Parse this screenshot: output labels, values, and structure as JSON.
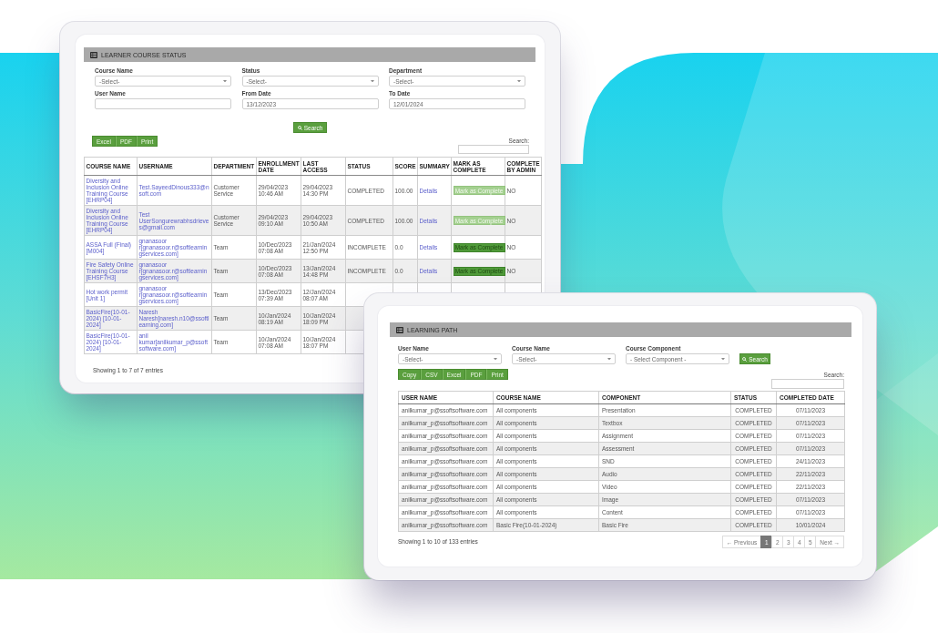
{
  "learner_course_status": {
    "title": "LEARNER COURSE STATUS",
    "filters": [
      {
        "kind": "select",
        "label": "Course Name",
        "value": "-Select-"
      },
      {
        "kind": "select",
        "label": "Status",
        "value": "-Select-"
      },
      {
        "kind": "select",
        "label": "Department",
        "value": "-Select-"
      },
      {
        "kind": "input",
        "label": "User Name"
      },
      {
        "kind": "input",
        "label": "From Date",
        "value": "13/12/2023"
      },
      {
        "kind": "input",
        "label": "To Date",
        "value": "12/01/2024"
      }
    ],
    "search_button": "Search",
    "export_buttons": [
      "Excel",
      "PDF",
      "Print"
    ],
    "table_search_label": "Search:",
    "table": {
      "columns": [
        {
          "label": "COURSE NAME",
          "kind": "link"
        },
        {
          "label": "USERNAME",
          "kind": "link"
        },
        {
          "label": "DEPARTMENT",
          "kind": "text"
        },
        {
          "label": "ENROLLMENT DATE",
          "kind": "text"
        },
        {
          "label": "LAST ACCESS",
          "kind": "text"
        },
        {
          "label": "STATUS",
          "kind": "text"
        },
        {
          "label": "SCORE",
          "kind": "text"
        },
        {
          "label": "SUMMARY",
          "kind": "link"
        },
        {
          "label": "MARK AS COMPLETE",
          "kind": "button"
        },
        {
          "label": "COMPLETE BY ADMIN",
          "kind": "text"
        }
      ],
      "rows": [
        {
          "cells": [
            "Diversity and Inclusion Online Training Course [EHRP04]",
            "Test.SayeedDinous333@nsoft.com",
            "Customer Service",
            "29/04/2023 10:46 AM",
            "29/04/2023 14:30 PM",
            "COMPLETED",
            "100.00",
            "Details",
            "Mark as Complete",
            "NO"
          ],
          "mark_as_complete_disabled": true
        },
        {
          "cells": [
            "Diversity and Inclusion Online Training Course [EHRP04]",
            "Test UserSongurewrabhsdrieves@gmail.com",
            "Customer Service",
            "29/04/2023 09:10 AM",
            "29/04/2023 10:50 AM",
            "COMPLETED",
            "100.00",
            "Details",
            "Mark as Complete",
            "NO"
          ],
          "mark_as_complete_disabled": true
        },
        {
          "cells": [
            "ASSA Full (Final) [M004]",
            "gnanasoor r[gnanasoor.r@softlearningservices.com]",
            "Team",
            "10/Dec/2023 07:08 AM",
            "21/Jan/2024 12:50 PM",
            "INCOMPLETE",
            "0.0",
            "Details",
            "Mark as Complete",
            "NO"
          ],
          "mark_as_complete_disabled": false
        },
        {
          "cells": [
            "Fire Safety Online Training Course [EHSF7H3]",
            "gnanasoor r[gnanasoor.r@softlearningservices.com]",
            "Team",
            "10/Dec/2023 07:08 AM",
            "13/Jan/2024 14:48 PM",
            "INCOMPLETE",
            "0.0",
            "Details",
            "Mark as Complete",
            "NO"
          ],
          "mark_as_complete_disabled": false
        },
        {
          "cells": [
            "Hot work permit [Unit 1]",
            "gnanasoor r[gnanasoor.r@softlearningservices.com]",
            "Team",
            "13/Dec/2023 07:39 AM",
            "12/Jan/2024 08:07 AM"
          ]
        },
        {
          "cells": [
            "BasicFire(10-01-2024) [10-01-2024]",
            "Naresh Naresh[naresh.n10@ssoftlearning.com]",
            "Team",
            "10/Jan/2024 08:19 AM",
            "10/Jan/2024 18:09 PM"
          ]
        },
        {
          "cells": [
            "BasicFire(10-01-2024) [10-01-2024]",
            "anil kumar[anilkumar_p@ssoftsoftware.com]",
            "Team",
            "10/Jan/2024 07:08 AM",
            "10/Jan/2024 18:07 PM"
          ]
        }
      ]
    },
    "footer": "Showing 1 to 7 of 7 entries"
  },
  "learning_path": {
    "title": "LEARNING PATH",
    "filters": [
      {
        "kind": "select",
        "label": "User Name",
        "value": "-Select-"
      },
      {
        "kind": "select",
        "label": "Course Name",
        "value": "-Select-"
      },
      {
        "kind": "select",
        "label": "Course Component",
        "value": "- Select Component -"
      }
    ],
    "search_button": "Search",
    "export_buttons": [
      "Copy",
      "CSV",
      "Excel",
      "PDF",
      "Print"
    ],
    "table_search_label": "Search:",
    "table": {
      "columns": [
        "USER NAME",
        "COURSE NAME",
        "COMPONENT",
        "STATUS",
        "COMPLETED DATE"
      ],
      "rows": [
        [
          "anilkumar_p@ssoftsoftware.com",
          "All components",
          "Presentation",
          "COMPLETED",
          "07/11/2023"
        ],
        [
          "anilkumar_p@ssoftsoftware.com",
          "All components",
          "Textbox",
          "COMPLETED",
          "07/11/2023"
        ],
        [
          "anilkumar_p@ssoftsoftware.com",
          "All components",
          "Assignment",
          "COMPLETED",
          "07/11/2023"
        ],
        [
          "anilkumar_p@ssoftsoftware.com",
          "All components",
          "Assessment",
          "COMPLETED",
          "07/11/2023"
        ],
        [
          "anilkumar_p@ssoftsoftware.com",
          "All components",
          "SND",
          "COMPLETED",
          "24/11/2023"
        ],
        [
          "anilkumar_p@ssoftsoftware.com",
          "All components",
          "Audio",
          "COMPLETED",
          "22/11/2023"
        ],
        [
          "anilkumar_p@ssoftsoftware.com",
          "All components",
          "Video",
          "COMPLETED",
          "22/11/2023"
        ],
        [
          "anilkumar_p@ssoftsoftware.com",
          "All components",
          "Image",
          "COMPLETED",
          "07/11/2023"
        ],
        [
          "anilkumar_p@ssoftsoftware.com",
          "All components",
          "Content",
          "COMPLETED",
          "07/11/2023"
        ],
        [
          "anilkumar_p@ssoftsoftware.com",
          "Basic Fire(10-01-2024)",
          "Basic Fire",
          "COMPLETED",
          "10/01/2024"
        ]
      ]
    },
    "footer": "Showing 1 to 10 of 133 entries",
    "pagination": {
      "previous": "← Previous",
      "pages": [
        {
          "label": "1",
          "selected": true
        },
        {
          "label": "2",
          "selected": false
        },
        {
          "label": "3",
          "selected": false
        },
        {
          "label": "4",
          "selected": false
        },
        {
          "label": "5",
          "selected": false
        }
      ],
      "next": "Next →"
    }
  }
}
